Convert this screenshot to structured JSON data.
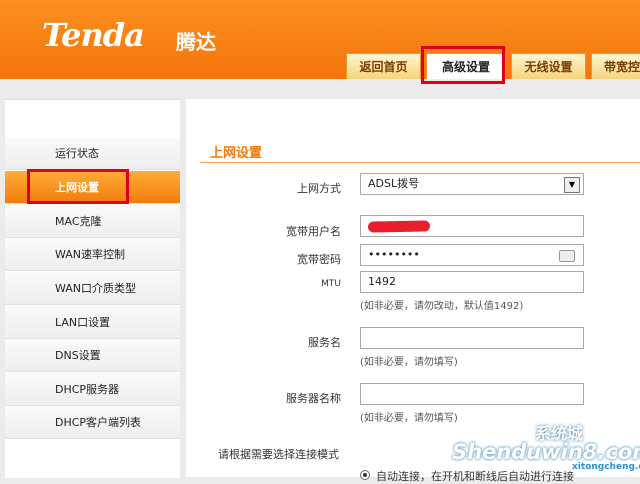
{
  "brand": {
    "logo": "Tenda",
    "name_cn": "腾达"
  },
  "tabs": [
    {
      "label": "返回首页"
    },
    {
      "label": "高级设置",
      "active": true
    },
    {
      "label": "无线设置"
    },
    {
      "label": "带宽控"
    }
  ],
  "sidebar": {
    "items": [
      {
        "label": "运行状态"
      },
      {
        "label": "上网设置",
        "active": true
      },
      {
        "label": "MAC克隆"
      },
      {
        "label": "WAN速率控制"
      },
      {
        "label": "WAN口介质类型"
      },
      {
        "label": "LAN口设置"
      },
      {
        "label": "DNS设置"
      },
      {
        "label": "DHCP服务器"
      },
      {
        "label": "DHCP客户端列表"
      }
    ]
  },
  "form": {
    "title": "上网设置",
    "mode_label": "上网方式",
    "mode_value": "ADSL拨号",
    "user_label": "宽带用户名",
    "pass_label": "宽带密码",
    "pass_value": "••••••••",
    "mtu_label": "MTU",
    "mtu_value": "1492",
    "mtu_hint": "(如非必要，请勿改动，默认值1492)",
    "service_label": "服务名",
    "service_hint": "(如非必要，请勿填写)",
    "server_label": "服务器名称",
    "server_hint": "(如非必要，请勿填写)",
    "conn_mode_label": "请根据需要选择连接模式",
    "auto_connect_label": "自动连接，在开机和断线后自动进行连接"
  },
  "watermark": {
    "text": "Shenduwin8.com",
    "sub": "系统城",
    "url": "xitongcheng.com"
  },
  "colors": {
    "header": "#f4750b",
    "accent": "#f07b0a",
    "highlight": "#e0001a"
  }
}
